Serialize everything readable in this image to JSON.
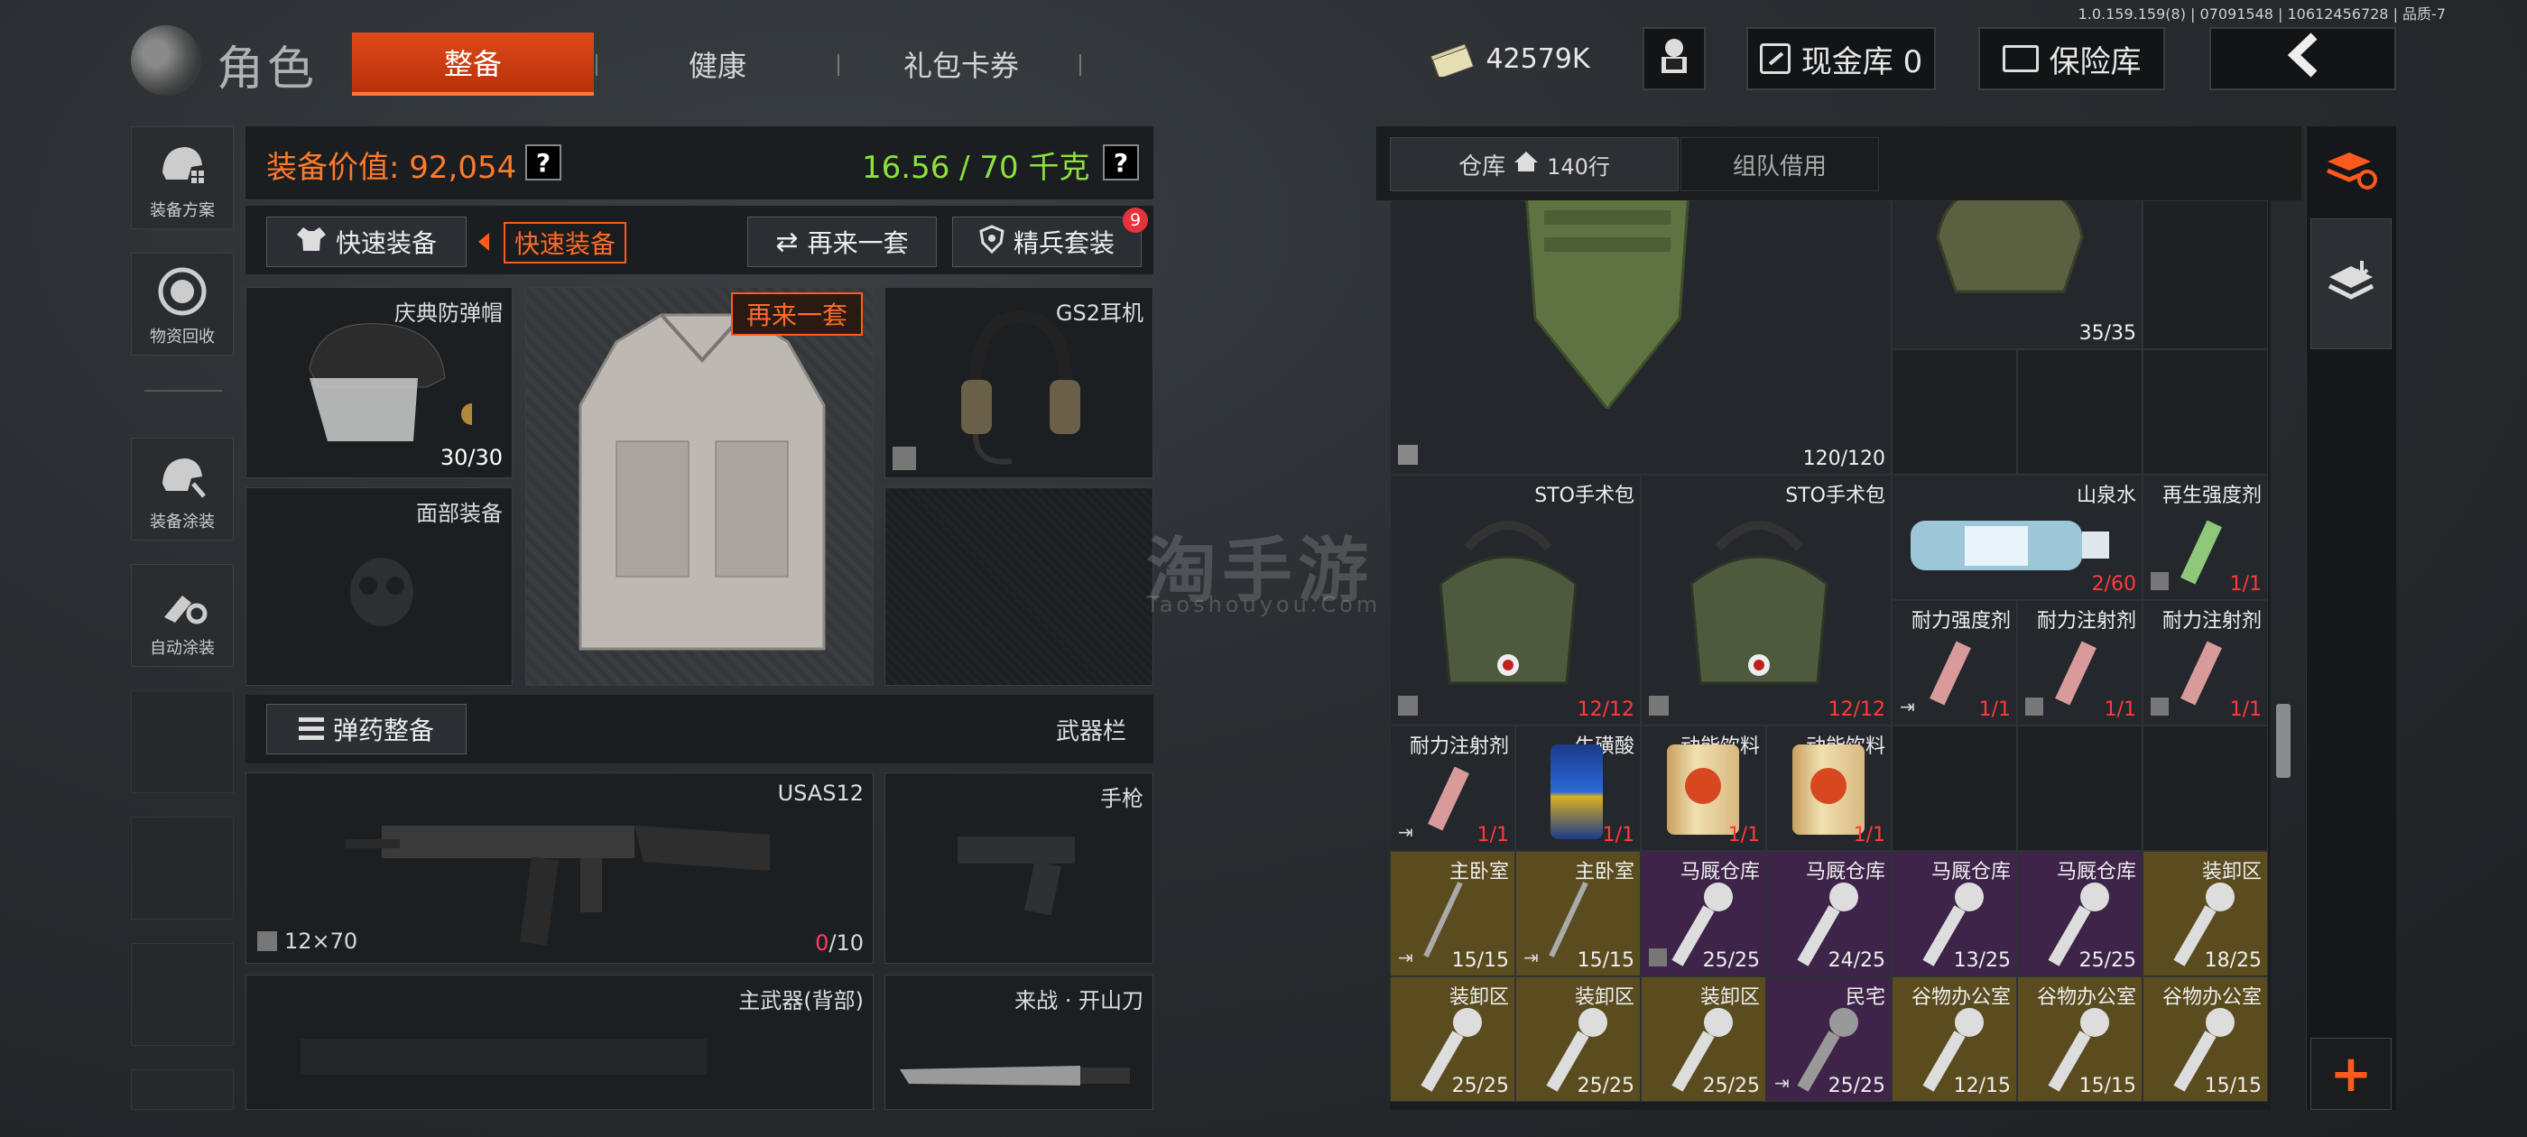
{
  "version": "1.0.159.159(8) | 07091548 | 10612456728 | 品质-7",
  "header": {
    "title": "角色",
    "tabs": [
      "整备",
      "健康",
      "礼包卡券"
    ],
    "money": "42579K",
    "cash_vault": "现金库 0",
    "safe_vault": "保险库"
  },
  "sidebar": {
    "items": [
      "装备方案",
      "物资回收",
      "装备涂装",
      "自动涂装"
    ]
  },
  "equipment": {
    "value_label": "装备价值: 92,054",
    "weight": "16.56 / 70 千克",
    "quick_equip": "快速装备",
    "quick_equip_tag": "快速装备",
    "again_set": "再来一套",
    "elite_set": "精兵套装",
    "elite_badge": "9",
    "again_tag": "再来一套",
    "helmet": {
      "name": "庆典防弹帽",
      "count": "30/30"
    },
    "face": {
      "name": "面部装备"
    },
    "headset": {
      "name": "GS2耳机"
    },
    "ammo_btn": "弹药整备",
    "weapon_bar": "武器栏",
    "primary": {
      "name": "USAS12",
      "ammo": "12×70",
      "mag_current": "0",
      "mag_total": "/10"
    },
    "pistol": {
      "name": "手枪"
    },
    "back": {
      "name": "主武器(背部)"
    },
    "melee": {
      "name": "来战 · 开山刀"
    }
  },
  "inventory": {
    "tab_warehouse": "仓库",
    "rows": "140行",
    "tab_team": "组队借用",
    "items": [
      {
        "name": "",
        "count": "120/120"
      },
      {
        "name": "",
        "count": "35/35"
      },
      {
        "name": "STO手术包",
        "count": "12/12"
      },
      {
        "name": "STO手术包",
        "count": "12/12"
      },
      {
        "name": "山泉水",
        "count": "2/60"
      },
      {
        "name": "再生强度剂",
        "count": "1/1"
      },
      {
        "name": "耐力强度剂",
        "count": "1/1"
      },
      {
        "name": "耐力注射剂",
        "count": "1/1"
      },
      {
        "name": "耐力注射剂",
        "count": "1/1"
      },
      {
        "name": "耐力注射剂",
        "count": "1/1"
      },
      {
        "name": "牛磺酸",
        "count": "1/1"
      },
      {
        "name": "动能饮料",
        "count": "1/1"
      },
      {
        "name": "动能饮料",
        "count": "1/1"
      },
      {
        "name": "主卧室",
        "count": "15/15"
      },
      {
        "name": "主卧室",
        "count": "15/15"
      },
      {
        "name": "马厩仓库",
        "count": "25/25"
      },
      {
        "name": "马厩仓库",
        "count": "24/25"
      },
      {
        "name": "马厩仓库",
        "count": "13/25"
      },
      {
        "name": "马厩仓库",
        "count": "25/25"
      },
      {
        "name": "装卸区",
        "count": "18/25"
      },
      {
        "name": "装卸区",
        "count": "25/25"
      },
      {
        "name": "装卸区",
        "count": "25/25"
      },
      {
        "name": "装卸区",
        "count": "25/25"
      },
      {
        "name": "民宅",
        "count": "25/25"
      },
      {
        "name": "谷物办公室",
        "count": "12/15"
      },
      {
        "name": "谷物办公室",
        "count": "15/15"
      },
      {
        "name": "谷物办公室",
        "count": "15/15"
      }
    ]
  },
  "watermark": {
    "cn": "淘手游",
    "en": "Taoshouyou.Com"
  },
  "colors": {
    "accent": "#e04a18",
    "weight_green": "#8ee03a",
    "value_orange": "#ff7a2a",
    "count_red": "#ff3a3a"
  }
}
